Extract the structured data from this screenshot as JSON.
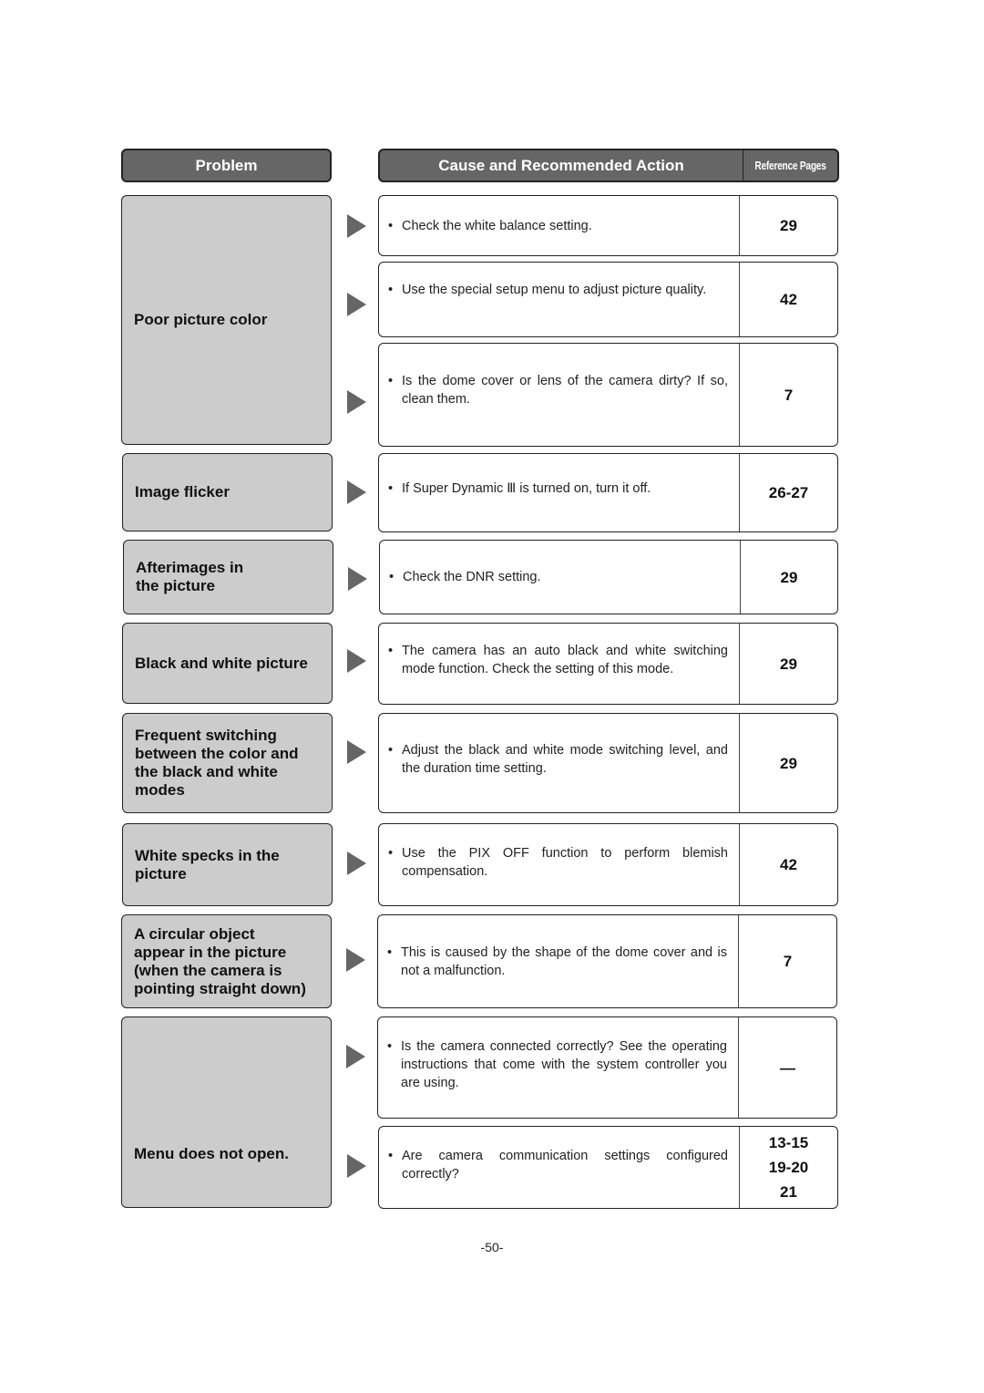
{
  "header": {
    "problem": "Problem",
    "cause": "Cause and Recommended Action",
    "reference": "Reference Pages"
  },
  "problems": [
    {
      "label": "Poor picture color"
    },
    {
      "label": "Image flicker"
    },
    {
      "label": "Afterimages in\nthe picture"
    },
    {
      "label": "Black and white picture"
    },
    {
      "label": "Frequent switching\nbetween the color and\nthe black and white\nmodes"
    },
    {
      "label": "White specks in the\npicture"
    },
    {
      "label": "A circular object\nappear in the picture\n(when the camera is\npointing straight down)"
    },
    {
      "label": "Menu does not open."
    }
  ],
  "causes": [
    {
      "text": "Check the white balance setting.",
      "refs": [
        "29"
      ]
    },
    {
      "text": "Use the special setup menu to adjust picture quality.",
      "refs": [
        "42"
      ]
    },
    {
      "text": "Is the dome cover or lens of the camera dirty? If so, clean them.",
      "refs": [
        "7"
      ]
    },
    {
      "text": "If Super Dynamic Ⅲ is turned on, turn it off.",
      "refs": [
        "26-27"
      ]
    },
    {
      "text": "Check the DNR setting.",
      "refs": [
        "29"
      ]
    },
    {
      "text": "The camera has an auto black and white switching mode function. Check the setting of this mode.",
      "refs": [
        "29"
      ]
    },
    {
      "text": "Adjust the black and white mode switching level, and the duration time setting.",
      "refs": [
        "29"
      ]
    },
    {
      "text": "Use the PIX OFF function to perform blemish compensation.",
      "refs": [
        "42"
      ]
    },
    {
      "text": "This is caused by the shape of the dome cover and is not a malfunction.",
      "refs": [
        "7"
      ]
    },
    {
      "text": "Is the camera connected correctly? See the operating instructions that come with the system controller you are using.",
      "refs": [
        "—"
      ]
    },
    {
      "text": "Are camera communication settings configured correctly?",
      "refs": [
        "13-15",
        "19-20",
        "21"
      ]
    }
  ],
  "bullet": "•",
  "page_number": "-50-"
}
